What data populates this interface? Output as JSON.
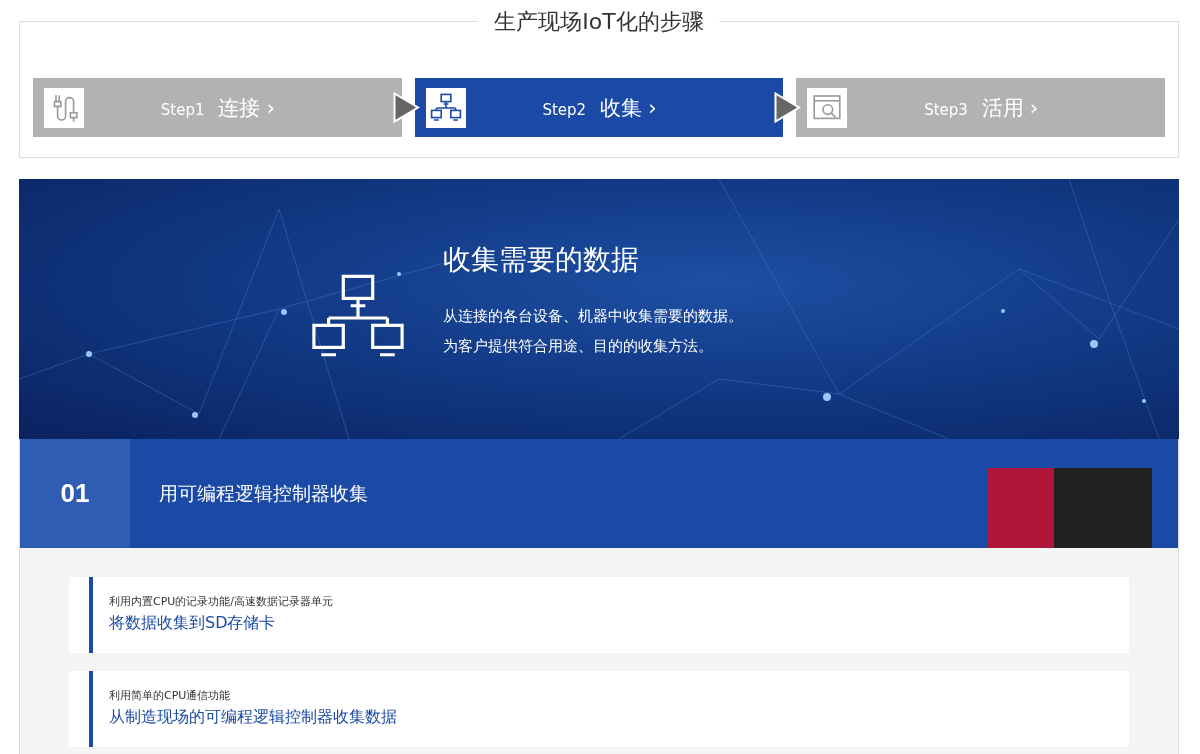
{
  "heading": "生产现场IoT化的步骤",
  "steps": [
    {
      "kind": "cable",
      "label": "Step1",
      "title": "连接",
      "chevron": "›",
      "selected": false
    },
    {
      "kind": "network",
      "label": "Step2",
      "title": "收集",
      "chevron": "›",
      "selected": true
    },
    {
      "kind": "analysis",
      "label": "Step3",
      "title": "活用",
      "chevron": "›",
      "selected": false
    }
  ],
  "hero": {
    "title": "收集需要的数据",
    "lines": [
      "从连接的各台设备、机器中收集需要的数据。",
      "为客户提供符合用途、目的的收集方法。"
    ]
  },
  "section": {
    "number": "01",
    "title": "用可编程逻辑控制器收集",
    "items": [
      {
        "subtitle": "利用内置CPU的记录功能/高速数据记录器单元",
        "title": "将数据收集到SD存储卡"
      },
      {
        "subtitle": "利用简单的CPU通信功能",
        "title": "从制造现场的可编程逻辑控制器收集数据"
      }
    ]
  }
}
